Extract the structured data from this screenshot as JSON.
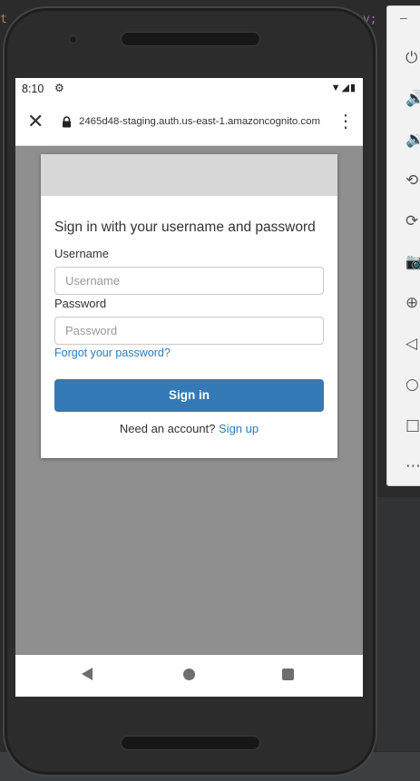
{
  "ide": {
    "left_code_fragment": "t",
    "right_code_fragment": "ty;"
  },
  "emulator_toolbar": {
    "minimize_label": "–",
    "items": [
      {
        "name": "power-icon",
        "glyph": "⏻"
      },
      {
        "name": "volume-up-icon",
        "glyph": "🔊"
      },
      {
        "name": "volume-down-icon",
        "glyph": "🔉"
      },
      {
        "name": "rotate-left-icon",
        "glyph": "⟲"
      },
      {
        "name": "rotate-right-icon",
        "glyph": "⟳"
      },
      {
        "name": "screenshot-icon",
        "glyph": "📷"
      },
      {
        "name": "zoom-icon",
        "glyph": "⊕"
      },
      {
        "name": "back-icon",
        "glyph": "◁"
      },
      {
        "name": "home-icon",
        "glyph": "○"
      },
      {
        "name": "overview-icon",
        "glyph": "□"
      },
      {
        "name": "more-icon",
        "glyph": "⋯"
      }
    ]
  },
  "statusbar": {
    "time": "8:10",
    "settings_glyph": "⚙",
    "system_glyphs": "▼◢▮"
  },
  "browser": {
    "close_glyph": "✕",
    "url": "2465d48-staging.auth.us-east-1.amazoncognito.com",
    "menu_glyph": "⋮"
  },
  "login": {
    "title": "Sign in with your username and password",
    "username_label": "Username",
    "username_placeholder": "Username",
    "username_value": "",
    "password_label": "Password",
    "password_placeholder": "Password",
    "password_value": "",
    "forgot_link": "Forgot your password?",
    "signin_button": "Sign in",
    "need_account_text": "Need an account?",
    "signup_link": "Sign up"
  },
  "colors": {
    "primary_button": "#337ab7",
    "link": "#2e7bb8",
    "overlay_background": "#8f8f8f",
    "banner": "#d7d7d7"
  }
}
